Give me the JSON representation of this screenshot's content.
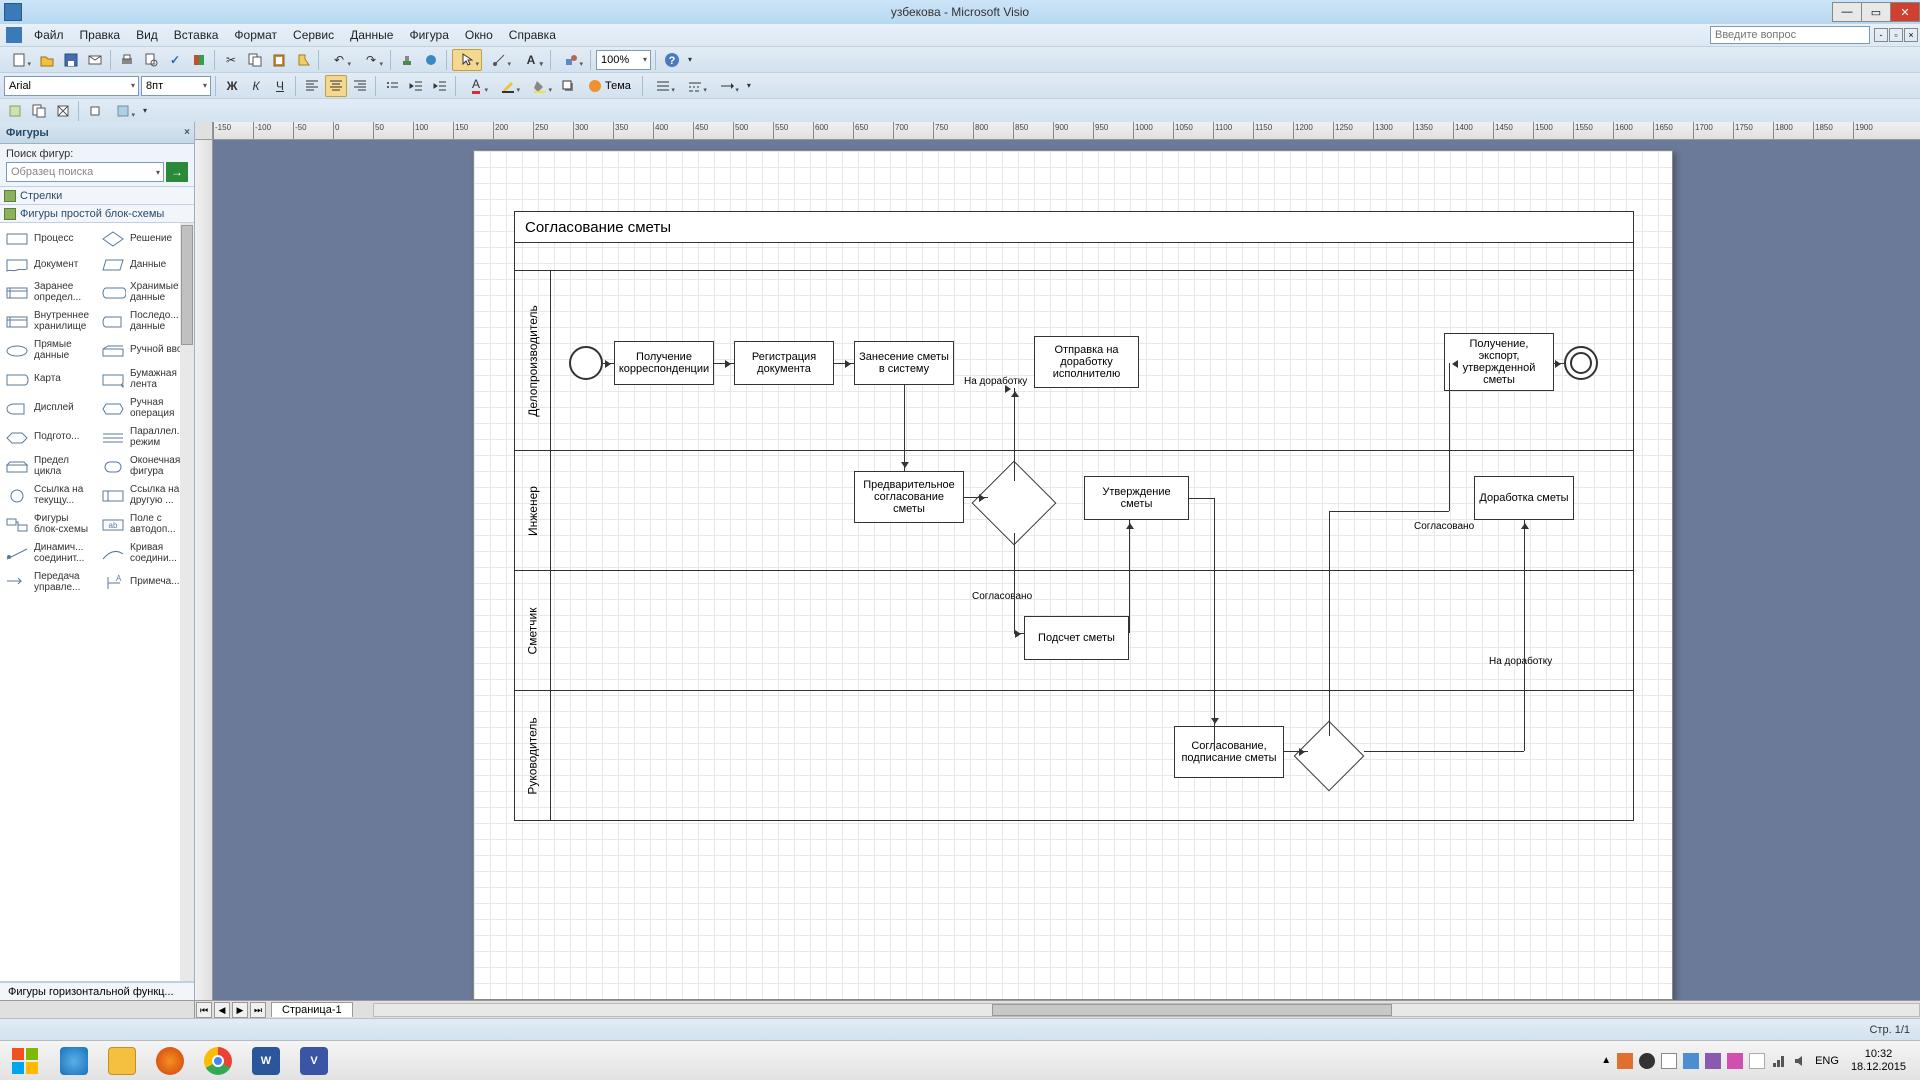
{
  "title": "узбекова - Microsoft Visio",
  "menu": [
    "Файл",
    "Правка",
    "Вид",
    "Вставка",
    "Формат",
    "Сервис",
    "Данные",
    "Фигура",
    "Окно",
    "Справка"
  ],
  "search_placeholder": "Введите вопрос",
  "toolbar": {
    "zoom": "100%",
    "font": "Arial",
    "size": "8пт",
    "theme": "Тема"
  },
  "shapes_pane": {
    "title": "Фигуры",
    "search_label": "Поиск фигур:",
    "search_placeholder": "Образец поиска",
    "stencils": [
      "Стрелки",
      "Фигуры простой блок-схемы"
    ],
    "shapes": [
      [
        "Процесс",
        "Решение"
      ],
      [
        "Документ",
        "Данные"
      ],
      [
        "Заранее определ...",
        "Хранимые данные"
      ],
      [
        "Внутреннее хранилище",
        "Последо... данные"
      ],
      [
        "Прямые данные",
        "Ручной ввод"
      ],
      [
        "Карта",
        "Бумажная лента"
      ],
      [
        "Дисплей",
        "Ручная операция"
      ],
      [
        "Подгото...",
        "Параллел... режим"
      ],
      [
        "Предел цикла",
        "Оконечная фигура"
      ],
      [
        "Ссылка на текущу...",
        "Ссылка на другую ..."
      ],
      [
        "Фигуры блок-схемы",
        "Поле с автодоп..."
      ],
      [
        "Динамич... соединит...",
        "Кривая соедини..."
      ],
      [
        "Передача управле...",
        "Примеча..."
      ]
    ],
    "footer": "Фигуры горизонтальной функц..."
  },
  "ruler_marks": [
    "-150",
    "-100",
    "-50",
    "0",
    "50",
    "100",
    "150",
    "200",
    "250",
    "300",
    "350",
    "400",
    "450",
    "500",
    "550",
    "600",
    "650",
    "700",
    "750",
    "800",
    "850",
    "900",
    "950",
    "1000",
    "1050",
    "1100",
    "1150",
    "1200",
    "1250",
    "1300",
    "1350",
    "1400",
    "1450",
    "1500",
    "1550",
    "1600",
    "1650",
    "1700",
    "1750",
    "1800",
    "1850",
    "1900"
  ],
  "diagram": {
    "title": "Согласование сметы",
    "lanes": [
      "Делопроизводитель",
      "Инженер",
      "Сметчик",
      "Руководитель"
    ],
    "boxes": {
      "b1": "Получение корреспонденции",
      "b2": "Регистрация документа",
      "b3": "Занесение сметы в систему",
      "b4": "Отправка на доработку исполнителю",
      "b5": "Получение, экспорт, утвержденной сметы",
      "b6": "Предварительное согласование сметы",
      "b7": "Утверждение сметы",
      "b8": "Доработка сметы",
      "b9": "Подсчет сметы",
      "b10": "Согласование, подписание сметы"
    },
    "labels": {
      "l1": "На доработку",
      "l2": "Согласовано",
      "l3": "Согласовано",
      "l4": "На доработку"
    }
  },
  "page_tab": "Страница-1",
  "status": "Стр. 1/1",
  "tray": {
    "lang": "ENG",
    "time": "10:32",
    "date": "18.12.2015"
  }
}
